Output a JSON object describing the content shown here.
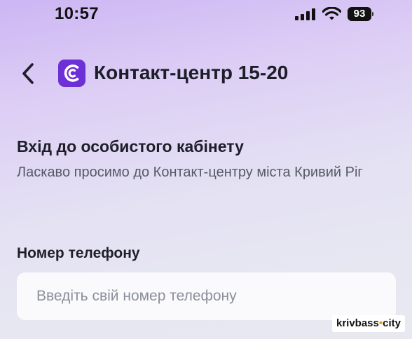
{
  "status_bar": {
    "time": "10:57",
    "battery_level": "93",
    "icons": [
      "cellular-signal-icon",
      "wifi-icon",
      "battery-icon"
    ]
  },
  "header": {
    "back_icon": "chevron-left-icon",
    "logo_icon": "contact-center-logo",
    "title": "Контакт-центр 15-20"
  },
  "login": {
    "heading": "Вхід до особистого кабінету",
    "welcome": "Ласкаво просимо до Контакт-центру міста Кривий Ріг"
  },
  "phone": {
    "label": "Номер телефону",
    "value": "",
    "placeholder": "Введіть свій номер телефону"
  },
  "watermark": {
    "part1": "krivbass",
    "dot": "•",
    "part2": "city"
  },
  "colors": {
    "brand_purple": "#6d2fd6",
    "background_top": "#cdb6f4",
    "background_bottom": "#e8e8f1",
    "text_primary": "#1e1e2a",
    "text_secondary": "#555a66",
    "placeholder": "#8b8f99"
  }
}
